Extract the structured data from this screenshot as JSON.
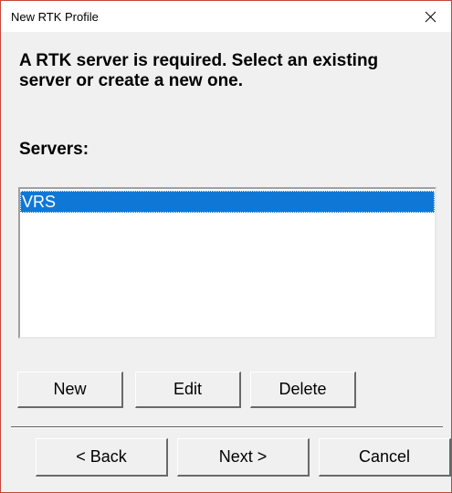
{
  "window": {
    "title": "New RTK Profile"
  },
  "icons": {
    "close": "close-icon"
  },
  "main": {
    "heading": "A RTK server is required. Select an existing server or create a new one.",
    "servers_label": "Servers:"
  },
  "servers": {
    "items": [
      {
        "label": "VRS",
        "selected": true
      }
    ]
  },
  "buttons": {
    "new": "New",
    "edit": "Edit",
    "delete": "Delete",
    "back": "< Back",
    "next": "Next >",
    "cancel": "Cancel"
  },
  "colors": {
    "selection": "#0f78d7",
    "dialog_bg": "#f0f0f0",
    "window_border": "#c4463a"
  }
}
